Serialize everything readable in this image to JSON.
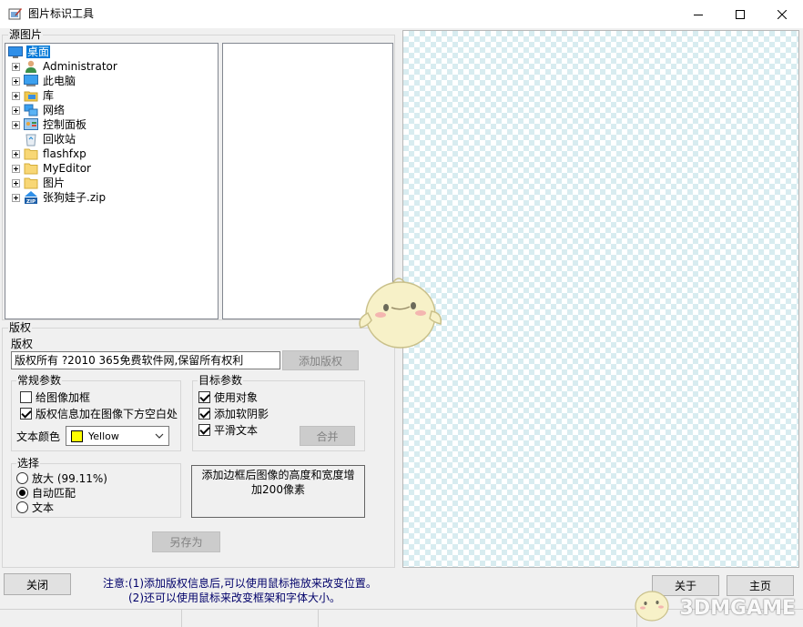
{
  "window": {
    "title": "图片标识工具",
    "icon": "app-icon",
    "controls": [
      "minimize-icon",
      "maximize-icon",
      "close-icon"
    ]
  },
  "source": {
    "label": "源图片",
    "tree": [
      {
        "label": "桌面",
        "icon": "desktop-icon",
        "selected": true,
        "expandable": false,
        "level": 0
      },
      {
        "label": "Administrator",
        "icon": "user-icon",
        "expandable": true,
        "level": 1
      },
      {
        "label": "此电脑",
        "icon": "computer-icon",
        "expandable": true,
        "level": 1
      },
      {
        "label": "库",
        "icon": "library-icon",
        "expandable": true,
        "level": 1
      },
      {
        "label": "网络",
        "icon": "network-icon",
        "expandable": true,
        "level": 1
      },
      {
        "label": "控制面板",
        "icon": "control-panel-icon",
        "expandable": true,
        "level": 1
      },
      {
        "label": "回收站",
        "icon": "recycle-bin-icon",
        "expandable": false,
        "level": 1
      },
      {
        "label": "flashfxp",
        "icon": "folder-icon",
        "expandable": true,
        "level": 1
      },
      {
        "label": "MyEditor",
        "icon": "folder-icon",
        "expandable": true,
        "level": 1
      },
      {
        "label": "图片",
        "icon": "folder-icon",
        "expandable": true,
        "level": 1
      },
      {
        "label": "张狗娃子.zip",
        "icon": "zip-icon",
        "expandable": true,
        "level": 1
      }
    ]
  },
  "copyright": {
    "group_label": "版权",
    "field_label": "版权",
    "value": "版权所有 ?2010 365免费软件网,保留所有权利",
    "add_button": "添加版权"
  },
  "general": {
    "label": "常规参数",
    "add_border": {
      "label": "给图像加框",
      "checked": false
    },
    "below_image": {
      "label": "版权信息加在图像下方空白处",
      "checked": true
    },
    "text_color_label": "文本颜色",
    "text_color_value": "Yellow",
    "text_color_swatch": "#ffff00"
  },
  "target": {
    "label": "目标参数",
    "use_object": {
      "label": "使用对象",
      "checked": true
    },
    "soft_shadow": {
      "label": "添加软阴影",
      "checked": true
    },
    "smooth_text": {
      "label": "平滑文本",
      "checked": true
    },
    "merge_button": "合并"
  },
  "select": {
    "label": "选择",
    "options": [
      {
        "label": "放大 (99.11%)",
        "selected": false
      },
      {
        "label": "自动匹配",
        "selected": true
      },
      {
        "label": "文本",
        "selected": false
      }
    ]
  },
  "info_box": "添加边框后图像的高度和宽度增加200像素",
  "save_as_button": "另存为",
  "bottom": {
    "close_button": "关闭",
    "note_line1": "注意:(1)添加版权信息后,可以使用鼠标拖放来改变位置。",
    "note_line2": "(2)还可以使用鼠标来改变框架和字体大小。",
    "about_button": "关于",
    "home_button": "主页"
  },
  "watermark": "3DMGAME"
}
